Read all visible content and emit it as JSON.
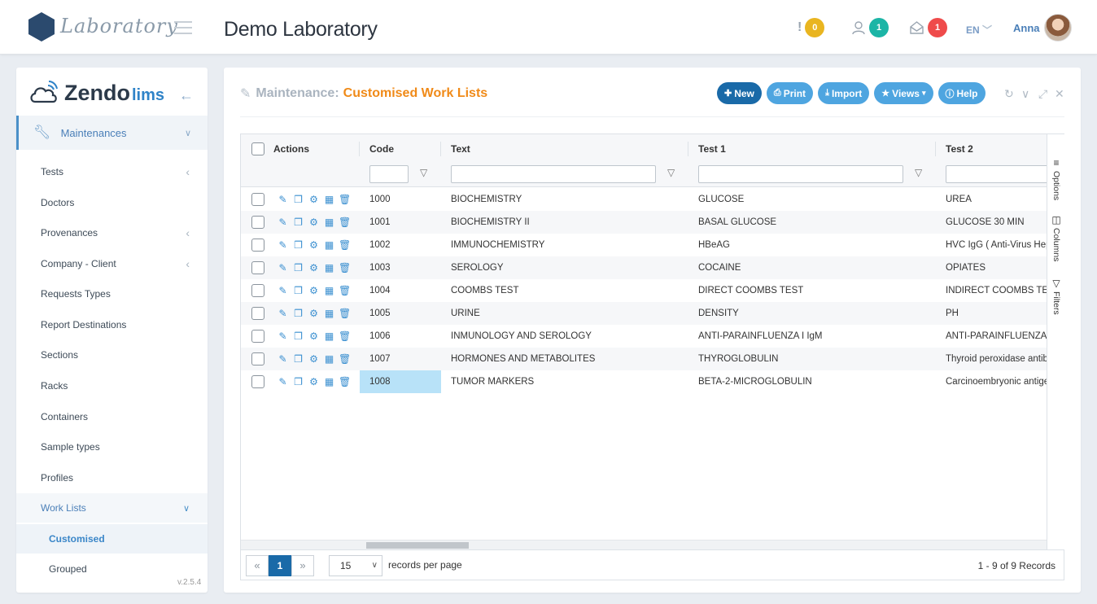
{
  "topbar": {
    "logo_text": "Laboratory",
    "lab_name": "Demo Laboratory",
    "alerts_count": "0",
    "users_count": "1",
    "messages_count": "1",
    "language": "EN",
    "user_name": "Anna",
    "colors": {
      "alert_badge": "#e9b520",
      "users_badge": "#1cb5a6",
      "messages_badge": "#ef4b4b"
    }
  },
  "sidebar": {
    "brand_main": "Zendo",
    "brand_sub": "lims",
    "section_label": "Maintenances",
    "items": [
      {
        "label": "Tests",
        "has_submenu": true
      },
      {
        "label": "Doctors",
        "has_submenu": false
      },
      {
        "label": "Provenances",
        "has_submenu": true
      },
      {
        "label": "Company - Client",
        "has_submenu": true
      },
      {
        "label": "Requests Types",
        "has_submenu": false
      },
      {
        "label": "Report Destinations",
        "has_submenu": false
      },
      {
        "label": "Sections",
        "has_submenu": false
      },
      {
        "label": "Racks",
        "has_submenu": false
      },
      {
        "label": "Containers",
        "has_submenu": false
      },
      {
        "label": "Sample types",
        "has_submenu": false
      },
      {
        "label": "Profiles",
        "has_submenu": false
      },
      {
        "label": "Work Lists",
        "has_submenu": true,
        "expanded": true
      }
    ],
    "sub_items": [
      {
        "label": "Customised",
        "active": true
      },
      {
        "label": "Grouped",
        "active": false
      }
    ],
    "version": "v.2.5.4"
  },
  "panel": {
    "crumb": "Maintenance:",
    "title": "Customised Work Lists",
    "buttons": {
      "new": "New",
      "print": "Print",
      "import": "Import",
      "views": "Views",
      "help": "Help"
    }
  },
  "grid": {
    "columns": {
      "actions": "Actions",
      "code": "Code",
      "text": "Text",
      "test1": "Test 1",
      "test2": "Test 2"
    },
    "side_tabs": {
      "options": "Options",
      "columns": "Columns",
      "filters": "Filters"
    },
    "rows": [
      {
        "code": "1000",
        "text": "BIOCHEMISTRY",
        "test1": "GLUCOSE",
        "test2": "UREA"
      },
      {
        "code": "1001",
        "text": "BIOCHEMISTRY II",
        "test1": "BASAL GLUCOSE",
        "test2": "GLUCOSE 30 MIN"
      },
      {
        "code": "1002",
        "text": "IMMUNOCHEMISTRY",
        "test1": "HBeAG",
        "test2": "HVC IgG ( Anti-Virus Hepat"
      },
      {
        "code": "1003",
        "text": "SEROLOGY",
        "test1": "COCAINE",
        "test2": "OPIATES"
      },
      {
        "code": "1004",
        "text": "COOMBS TEST",
        "test1": "DIRECT COOMBS TEST",
        "test2": "INDIRECT COOMBS TEST"
      },
      {
        "code": "1005",
        "text": "URINE",
        "test1": "DENSITY",
        "test2": "PH"
      },
      {
        "code": "1006",
        "text": "INMUNOLOGY AND SEROLOGY",
        "test1": "ANTI-PARAINFLUENZA I IgM",
        "test2": "ANTI-PARAINFLUENZA I Ig"
      },
      {
        "code": "1007",
        "text": "HORMONES AND METABOLITES",
        "test1": "THYROGLOBULIN",
        "test2": "Thyroid peroxidase antibod"
      },
      {
        "code": "1008",
        "text": "TUMOR MARKERS",
        "test1": "BETA-2-MICROGLOBULIN",
        "test2": "Carcinoembryonic antigen"
      }
    ],
    "selected_code_row": 8
  },
  "footer": {
    "current_page": "1",
    "page_size": "15",
    "records_per_page": "records per page",
    "records_summary": "1 - 9 of 9 Records"
  }
}
